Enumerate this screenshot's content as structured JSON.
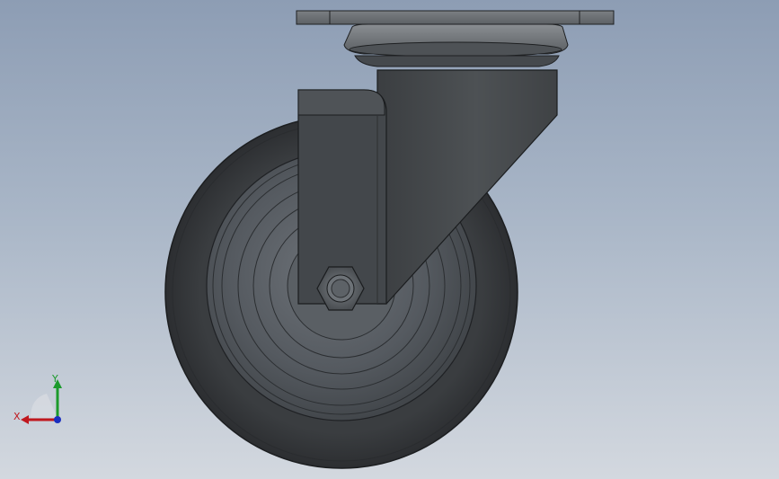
{
  "viewport": {
    "model_name": "",
    "colors": {
      "background_top": "#8d9db4",
      "background_bottom": "#d3d8df",
      "tire": "#3a3d40",
      "hub": "#5b6066",
      "bracket": "#45494d",
      "top_plate": "#6e7276",
      "x_axis": "#c0181e",
      "y_axis": "#1b9a2b",
      "z_axis": "#1a2fbf"
    }
  },
  "triad": {
    "x_label": "X",
    "y_label": "Y"
  }
}
